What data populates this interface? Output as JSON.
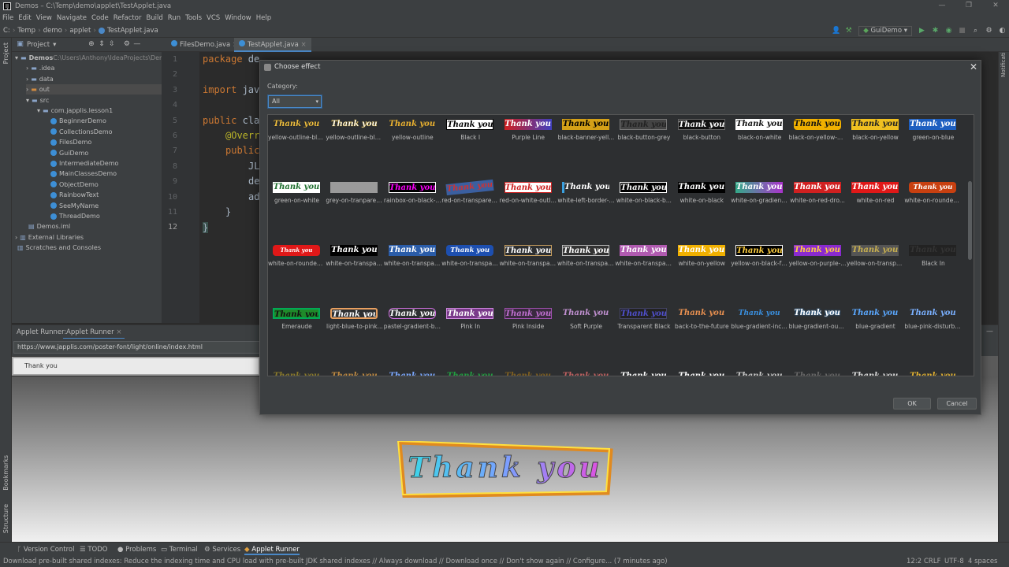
{
  "window": {
    "title": "Demos – C:\\Temp\\demo\\applet\\TestApplet.java",
    "controls": [
      "—",
      "❐",
      "✕"
    ]
  },
  "menu": [
    "File",
    "Edit",
    "View",
    "Navigate",
    "Code",
    "Refactor",
    "Build",
    "Run",
    "Tools",
    "VCS",
    "Window",
    "Help"
  ],
  "breadcrumb": [
    "C:",
    "Temp",
    "demo",
    "applet",
    "TestApplet.java"
  ],
  "run_config": "GuiDemo",
  "project_panel": {
    "title": "Project"
  },
  "tree": [
    {
      "label": "Demos",
      "extra": "C:\\Users\\Anthony\\IdeaProjects\\Demos",
      "kind": "module"
    },
    {
      "label": ".idea",
      "kind": "folder"
    },
    {
      "label": "data",
      "kind": "folder"
    },
    {
      "label": "out",
      "kind": "folder"
    },
    {
      "label": "src",
      "kind": "folder"
    },
    {
      "label": "com.japplis.lesson1",
      "kind": "package"
    },
    {
      "label": "BeginnerDemo",
      "kind": "class"
    },
    {
      "label": "CollectionsDemo",
      "kind": "class"
    },
    {
      "label": "FilesDemo",
      "kind": "class"
    },
    {
      "label": "GuiDemo",
      "kind": "class"
    },
    {
      "label": "IntermediateDemo",
      "kind": "class"
    },
    {
      "label": "MainClassesDemo",
      "kind": "class"
    },
    {
      "label": "ObjectDemo",
      "kind": "class"
    },
    {
      "label": "RainbowText",
      "kind": "class"
    },
    {
      "label": "SeeMyName",
      "kind": "class"
    },
    {
      "label": "ThreadDemo",
      "kind": "class"
    },
    {
      "label": "Demos.iml",
      "kind": "file"
    },
    {
      "label": "External Libraries",
      "kind": "lib"
    },
    {
      "label": "Scratches and Consoles",
      "kind": "lib"
    }
  ],
  "editor_tabs": [
    "FilesDemo.java",
    "TestApplet.java"
  ],
  "line_numbers": [
    "1",
    "2",
    "3",
    "4",
    "5",
    "6",
    "7",
    "8",
    "9",
    "10",
    "11",
    "12"
  ],
  "code": {
    "l1a": "package ",
    "l1b": "de",
    "l3a": "import ",
    "l3b": "jav",
    "l5a": "public ",
    "l5b": "cla",
    "l6": "@Overr",
    "l7a": "public",
    "l8": "JL",
    "l9": "de",
    "l10": "ad",
    "l11": "}",
    "l12": "}"
  },
  "bottom_tabs": [
    "Applet Runner:",
    "Applet Runner"
  ],
  "applet": {
    "url": "https://www.japplis.com/poster-font/light/online/index.html",
    "text_value": "Thank you",
    "preview_text": "Thank you"
  },
  "dialog": {
    "title": "Choose effect",
    "category_label": "Category:",
    "category_value": "All",
    "sample_text": "Thank you",
    "effects": [
      "yellow-outline-bla...",
      "yellow-outline-bla...",
      "yellow-outline",
      "Black I",
      "Purple Line",
      "black-banner-yell...",
      "black-button-grey",
      "black-button",
      "black-on-white",
      "black-on-yellow-b...",
      "black-on-yellow",
      "green-on-blue",
      "green-on-white",
      "grey-on-tranparen...",
      "rainbox-on-black-...",
      "red-on-transparen...",
      "red-on-white-outli...",
      "white-left-border-...",
      "white-on-black-b...",
      "white-on-black",
      "white-on-gradient...",
      "white-on-red-dro...",
      "white-on-red",
      "white-on-rounded...",
      "white-on-rounded...",
      "white-on-transpar...",
      "white-on-transpar...",
      "white-on-transpar...",
      "white-on-transpar...",
      "white-on-transpar...",
      "white-on-transpar...",
      "white-on-yellow",
      "yellow-on-black-fr...",
      "yellow-on-purple-...",
      "yellow-on-transpa...",
      "Black In",
      "Emeraude",
      "light-blue-to-pink...",
      "pastel-gradient-bo...",
      "Pink In",
      "Pink Inside",
      "Soft Purple",
      "Transparent Black",
      "back-to-the-future",
      "blue-gradient-incli...",
      "blue-gradient-outli...",
      "blue-gradient",
      "blue-pink-disturbed"
    ],
    "ok_label": "OK",
    "cancel_label": "Cancel"
  },
  "status": {
    "tabs": [
      "Version Control",
      "TODO",
      "Problems",
      "Terminal",
      "Services",
      "Applet Runner"
    ],
    "message": "Download pre-built shared indexes: Reduce the indexing time and CPU load with pre-built JDK shared indexes // Always download // Download once // Don't show again // Configure... (7 minutes ago)",
    "position": "12:2",
    "line_sep": "CRLF",
    "encoding": "UTF-8",
    "indent": "4 spaces"
  },
  "side_tools": {
    "left": [
      "Project",
      "Bookmarks",
      "Structure"
    ],
    "right": [
      "Notifications"
    ]
  }
}
